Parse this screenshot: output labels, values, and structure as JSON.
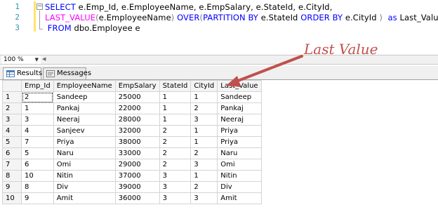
{
  "editor": {
    "line_numbers": [
      "1",
      "2",
      "3"
    ],
    "line1": {
      "select": "SELECT",
      "fields": " e.Emp_Id, e.EmployeeName, e.EmpSalary, e.StateId, e.CityId,"
    },
    "line2": {
      "func": "LAST_VALUE",
      "p1": "(",
      "arg": "e.EmployeeName",
      "p2": ")",
      "over": " OVER",
      "p3": "(",
      "partition": "PARTITION BY",
      "state": " e.StateId ",
      "order": "ORDER BY",
      "city": " e.CityId ",
      "p4": ")",
      "as": "  as ",
      "alias": "Last_Value"
    },
    "line3": {
      "from": "FROM",
      "table": " dbo.Employee e"
    }
  },
  "zoom": {
    "value": "100 %"
  },
  "tabs": {
    "results": "Results",
    "messages": "Messages"
  },
  "grid": {
    "columns": [
      "Emp_Id",
      "EmployeeName",
      "EmpSalary",
      "StateId",
      "CityId",
      "Last_Value"
    ],
    "rows": [
      [
        "1",
        "2",
        "Sandeep",
        "25000",
        "1",
        "1",
        "Sandeep"
      ],
      [
        "2",
        "1",
        "Pankaj",
        "22000",
        "1",
        "2",
        "Pankaj"
      ],
      [
        "3",
        "3",
        "Neeraj",
        "28000",
        "1",
        "3",
        "Neeraj"
      ],
      [
        "4",
        "4",
        "Sanjeev",
        "32000",
        "2",
        "1",
        "Priya"
      ],
      [
        "5",
        "7",
        "Priya",
        "38000",
        "2",
        "1",
        "Priya"
      ],
      [
        "6",
        "5",
        "Naru",
        "33000",
        "2",
        "2",
        "Naru"
      ],
      [
        "7",
        "6",
        "Omi",
        "29000",
        "2",
        "3",
        "Omi"
      ],
      [
        "8",
        "10",
        "Nitin",
        "37000",
        "3",
        "1",
        "Nitin"
      ],
      [
        "9",
        "8",
        "Div",
        "39000",
        "3",
        "2",
        "Div"
      ],
      [
        "10",
        "9",
        "Amit",
        "36000",
        "3",
        "3",
        "Amit"
      ]
    ]
  },
  "annotation": {
    "label": "Last Value",
    "color": "#c0504d"
  }
}
